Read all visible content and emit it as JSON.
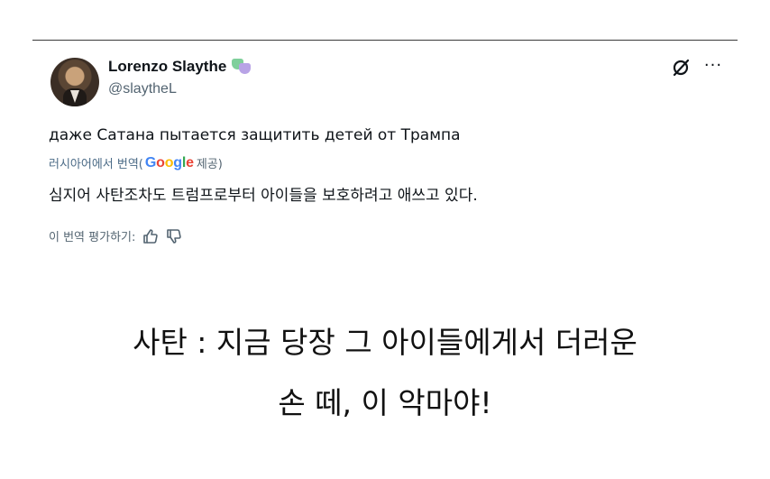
{
  "tweet": {
    "display_name": "Lorenzo Slaythe",
    "handle": "@slaytheL",
    "original_text": "даже Сатана пытается защитить детей от Трампа",
    "translated_from": "러시아어에서 번역(",
    "translator": "Google",
    "translator_suffix": " 제공)",
    "translated_text": "심지어 사탄조차도 트럼프로부터 아이들을 보호하려고 애쓰고 있다.",
    "rate_label": "이 번역 평가하기:",
    "icons": [
      "masks-icon",
      "grok-icon",
      "more-icon",
      "thumbs-up-icon",
      "thumbs-down-icon"
    ]
  },
  "caption": {
    "line1": "사탄 : 지금 당장 그 아이들에게서 더러운",
    "line2": "손 떼, 이 악마야!"
  }
}
